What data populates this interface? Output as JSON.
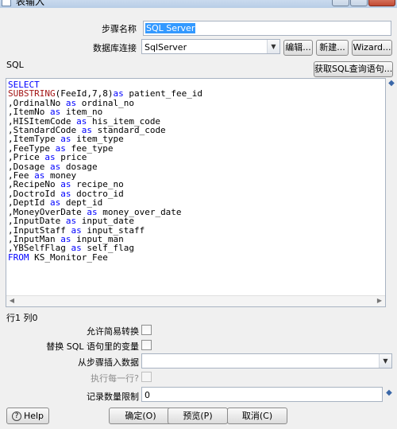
{
  "window": {
    "title": "表输入"
  },
  "form": {
    "step_name_label": "步骤名称",
    "step_name_value": "SQL Server",
    "connection_label": "数据库连接",
    "connection_value": "SqlServer",
    "edit_button": "编辑...",
    "new_button": "新建...",
    "wizard_button": "Wizard...",
    "sql_label": "SQL",
    "get_sql_button": "获取SQL查询语句..."
  },
  "sql": {
    "lines": [
      "SELECT",
      "SUBSTRING(FeeId,7,8)as patient_fee_id",
      ",OrdinalNo as ordinal_no",
      ",ItemNo as item_no",
      ",HISItemCode as his_item_code",
      ",StandardCode as standard_code",
      ",ItemType as item_type",
      ",FeeType as fee_type",
      ",Price as price",
      ",Dosage as dosage",
      ",Fee as money",
      ",RecipeNo as recipe_no",
      ",DoctroId as doctro_id",
      ",DeptId as dept_id",
      ",MoneyOverDate as money_over_date",
      ",InputDate as input_date",
      ",InputStaff as input_staff",
      ",InputMan as input_man",
      ",YBSelfFlag as self_flag",
      "FROM KS_Monitor_Fee"
    ]
  },
  "status": {
    "cursor_position": "行1 列0"
  },
  "options": {
    "lazy_conversion_label": "允许简易转换",
    "replace_variables_label": "替换 SQL 语句里的变量",
    "insert_from_step_label": "从步骤插入数据",
    "insert_from_step_value": "",
    "execute_each_row_label": "执行每一行?",
    "limit_label": "记录数量限制",
    "limit_value": "0"
  },
  "footer": {
    "help_button": "Help",
    "ok_button": "确定(O)",
    "preview_button": "预览(P)",
    "cancel_button": "取消(C)"
  }
}
